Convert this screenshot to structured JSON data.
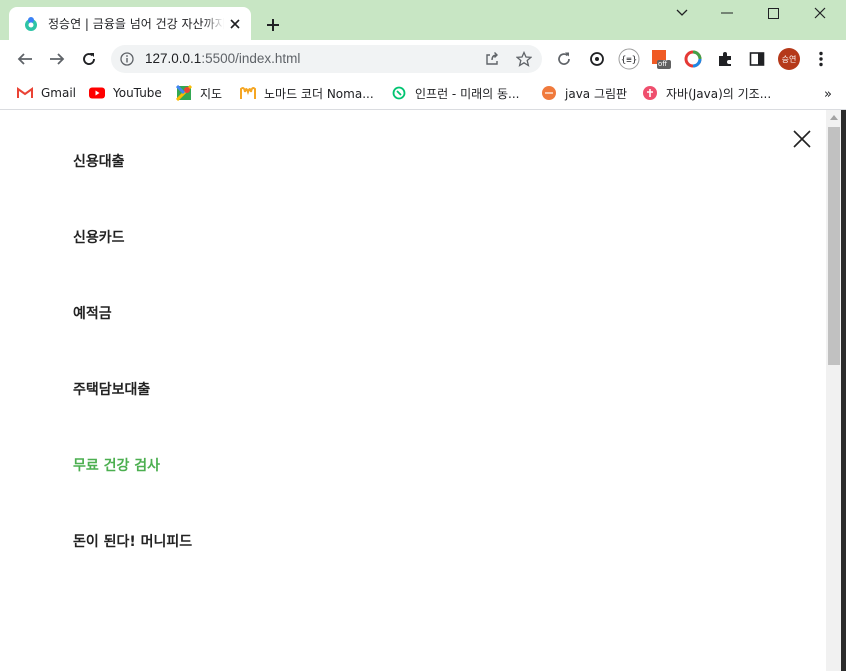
{
  "browser": {
    "tab": {
      "title": "정승연 | 금융을 넘어 건강 자산까지",
      "favicon": "toss-logo-icon"
    },
    "new_tab": "+",
    "address": {
      "host": "127.0.0.1",
      "rest": ":5500/index.html"
    },
    "profile_initials": "승연",
    "colors": {
      "tabstrip": "#c8e6c4",
      "avatar": "#b5391a",
      "accent": "#4caf50"
    },
    "bookmarks": [
      {
        "label": "Gmail",
        "icon": "gmail-icon"
      },
      {
        "label": "YouTube",
        "icon": "youtube-icon"
      },
      {
        "label": "지도",
        "icon": "maps-icon"
      },
      {
        "label": "노마드 코더 Noma...",
        "icon": "nomad-coders-icon"
      },
      {
        "label": "인프런 - 미래의 동...",
        "icon": "inflearn-icon"
      },
      {
        "label": "java 그림판",
        "icon": "java-paint-icon"
      },
      {
        "label": "자바(Java)의 기조...",
        "icon": "java-basics-icon"
      }
    ],
    "bookmarks_more": "»",
    "extension_badge": "off"
  },
  "page": {
    "menu": [
      {
        "label": "신용대출",
        "active": false
      },
      {
        "label": "신용카드",
        "active": false
      },
      {
        "label": "예적금",
        "active": false
      },
      {
        "label": "주택담보대출",
        "active": false
      },
      {
        "label": "무료 건강 검사",
        "active": true
      },
      {
        "label": "돈이 된다! 머니피드",
        "active": false
      }
    ]
  }
}
